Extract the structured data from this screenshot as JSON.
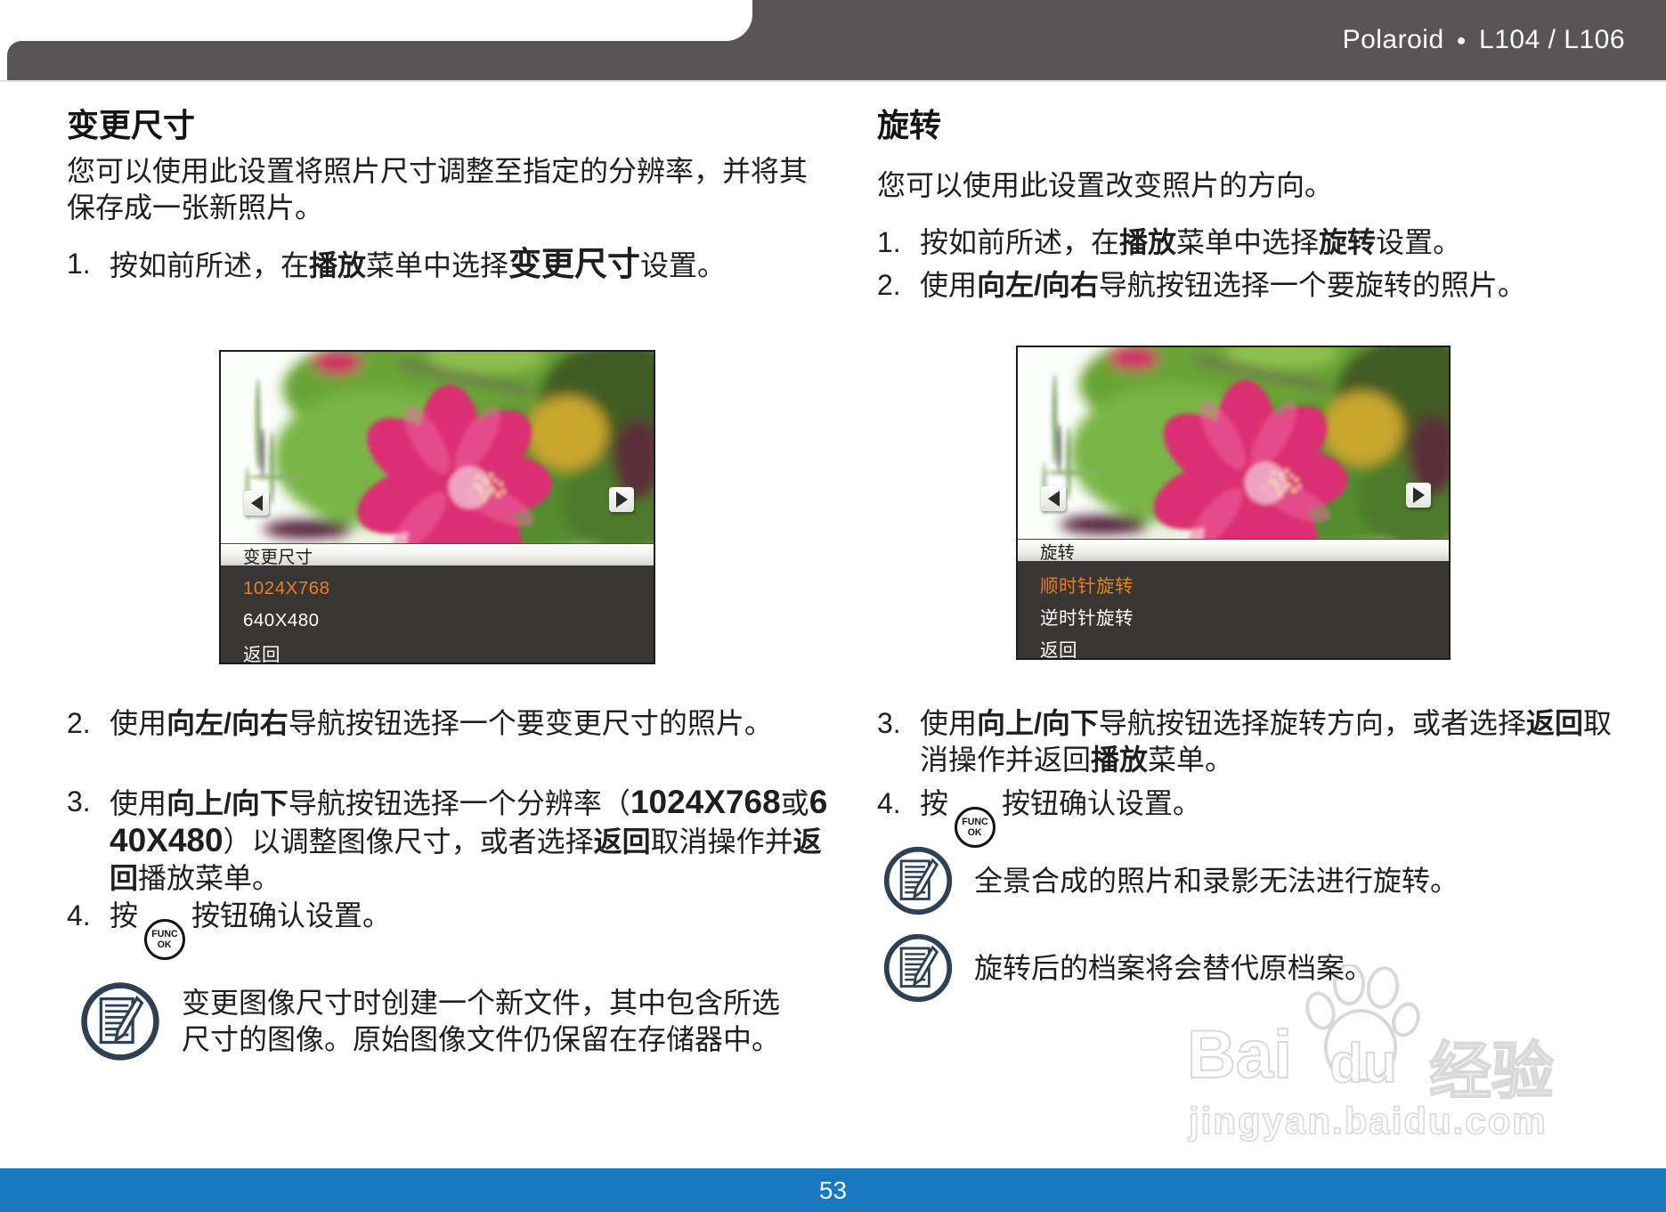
{
  "header": {
    "brand": "Polaroid",
    "bullet": "●",
    "model": "L104 / L106"
  },
  "left_section": {
    "title": "变更尺寸",
    "intro": "您可以使用此设置将照片尺寸调整至指定的分辨率，并将其保存成一张新照片。",
    "steps": [
      {
        "num": "1.",
        "segments": [
          {
            "t": "按如前所述，在"
          },
          {
            "t": "播放",
            "b": true
          },
          {
            "t": "菜单中选择"
          },
          {
            "t": "变更尺寸",
            "b": true,
            "big": true
          },
          {
            "t": "设置。"
          }
        ]
      },
      {
        "num": "2.",
        "segments": [
          {
            "t": "使用"
          },
          {
            "t": "向左/向右",
            "b": true
          },
          {
            "t": "导航按钮选择一个要变更尺寸的照片。"
          }
        ]
      },
      {
        "num": "3.",
        "segments": [
          {
            "t": "使用"
          },
          {
            "t": "向上/向下",
            "b": true
          },
          {
            "t": "导航按钮选择一个分辨率（"
          },
          {
            "t": "1024X768",
            "b": true,
            "big": true
          },
          {
            "t": "或"
          },
          {
            "t": "640X480",
            "b": true,
            "big": true
          },
          {
            "t": "）以调整图像尺寸，或者选择"
          },
          {
            "t": "返回",
            "b": true
          },
          {
            "t": "取消操作并"
          },
          {
            "t": "返回",
            "b": true
          },
          {
            "t": "播放菜单。"
          }
        ]
      },
      {
        "num": "4.",
        "segments": [
          {
            "t": "按"
          },
          {
            "icon": "func-ok",
            "top": "FUNC",
            "bottom": "OK"
          },
          {
            "t": "按钮确认设置。"
          }
        ]
      }
    ],
    "screen": {
      "title": "变更尺寸",
      "items": [
        {
          "label": "1024X768",
          "selected": true
        },
        {
          "label": "640X480",
          "selected": false
        },
        {
          "label": "返回",
          "selected": false
        }
      ]
    },
    "note": "变更图像尺寸时创建一个新文件，其中包含所选尺寸的图像。原始图像文件仍保留在存储器中。"
  },
  "right_section": {
    "title": "旋转",
    "intro": "您可以使用此设置改变照片的方向。",
    "steps": [
      {
        "num": "1.",
        "segments": [
          {
            "t": "按如前所述，在"
          },
          {
            "t": "播放",
            "b": true
          },
          {
            "t": "菜单中选择"
          },
          {
            "t": "旋转",
            "b": true
          },
          {
            "t": "设置。"
          }
        ]
      },
      {
        "num": "2.",
        "segments": [
          {
            "t": "使用"
          },
          {
            "t": "向左/向右",
            "b": true
          },
          {
            "t": "导航按钮选择一个要旋转的照片。"
          }
        ]
      },
      {
        "num": "3.",
        "segments": [
          {
            "t": "使用"
          },
          {
            "t": "向上/向下",
            "b": true
          },
          {
            "t": "导航按钮选择旋转方向，或者选择"
          },
          {
            "t": "返回",
            "b": true
          },
          {
            "t": "取消操作并返回"
          },
          {
            "t": "播放",
            "b": true
          },
          {
            "t": "菜单。"
          }
        ]
      },
      {
        "num": "4.",
        "segments": [
          {
            "t": "按"
          },
          {
            "icon": "func-ok",
            "top": "FUNC",
            "bottom": "OK"
          },
          {
            "t": "按钮确认设置。"
          }
        ]
      }
    ],
    "screen": {
      "title": "旋转",
      "items": [
        {
          "label": "顺时针旋转",
          "selected": true
        },
        {
          "label": "逆时针旋转",
          "selected": false
        },
        {
          "label": "返回",
          "selected": false
        }
      ]
    },
    "notes": [
      "全景合成的照片和录影无法进行旋转。",
      "旋转后的档案将会替代原档案。"
    ]
  },
  "watermark": {
    "logo_bai": "Bai",
    "logo_du": "du",
    "logo_cn": "经验",
    "url": "jingyan.baidu.com"
  },
  "footer": {
    "page_number": "53"
  },
  "colors": {
    "header_gray": "#585557",
    "accent_orange": "#e5801f",
    "footer_blue": "#1878c0",
    "note_icon": "#2e4154"
  }
}
